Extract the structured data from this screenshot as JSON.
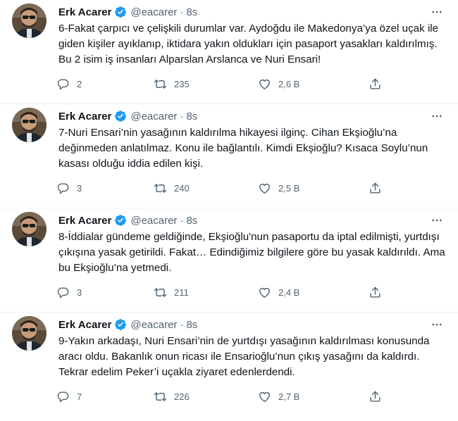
{
  "tweets": [
    {
      "author_name": "Erk Acarer",
      "handle": "@eacarer",
      "separator": "·",
      "time": "8s",
      "text": "6-Fakat çarpıcı ve çelişkili durumlar var. Aydoğdu ile Makedonya’ya özel uçak ile giden kişiler ayıklanıp, iktidara yakın oldukları için pasaport yasakları kaldırılmış. Bu 2 isim iş insanları Alparslan Arslanca ve Nuri Ensari!",
      "replies": "2",
      "retweets": "235",
      "likes": "2,6 B"
    },
    {
      "author_name": "Erk Acarer",
      "handle": "@eacarer",
      "separator": "·",
      "time": "8s",
      "text": "7-Nuri Ensari’nin yasağının kaldırılma hikayesi ilginç. Cihan Ekşioğlu’na değinmeden anlatılmaz. Konu ile bağlantılı. Kimdi Ekşioğlu? Kısaca Soylu’nun kasası olduğu iddia edilen kişi.",
      "replies": "3",
      "retweets": "240",
      "likes": "2,5 B"
    },
    {
      "author_name": "Erk Acarer",
      "handle": "@eacarer",
      "separator": "·",
      "time": "8s",
      "text": "8-İddialar gündeme geldiğinde, Ekşioğlu'nun pasaportu da iptal edilmişti, yurtdışı çıkışına yasak getirildi. Fakat… Edindiğimiz bilgilere göre bu yasak kaldırıldı. Ama bu Ekşioğlu’na yetmedi.",
      "replies": "3",
      "retweets": "211",
      "likes": "2,4 B"
    },
    {
      "author_name": "Erk Acarer",
      "handle": "@eacarer",
      "separator": "·",
      "time": "8s",
      "text": "9-Yakın arkadaşı, Nuri Ensari’nin de yurtdışı yasağının kaldırılması konusunda aracı oldu. Bakanlık onun ricası ile Ensarioğlu’nun çıkış yasağını da kaldırdı. Tekrar edelim Peker’i uçakla ziyaret edenlerdendi.",
      "replies": "7",
      "retweets": "226",
      "likes": "2,7 B"
    }
  ],
  "colors": {
    "text": "#0f1419",
    "secondary": "#536471",
    "verified": "#1d9bf0",
    "divider": "#eff3f4"
  },
  "icons": {
    "reply": "reply-icon",
    "retweet": "retweet-icon",
    "like": "like-icon",
    "share": "share-icon",
    "verified": "verified-badge-icon",
    "more": "more-icon"
  }
}
